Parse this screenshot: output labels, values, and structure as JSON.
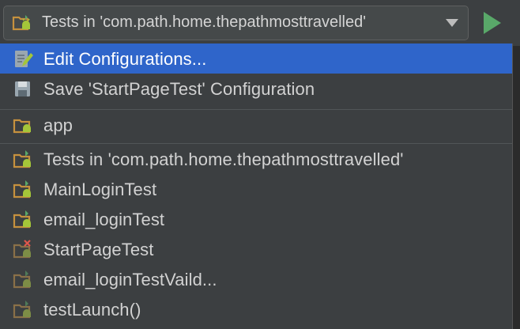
{
  "toolbar": {
    "config_selector_label": "Tests in 'com.path.home.thepathmosttravelled'",
    "config_selector_icon": "android-test-folder-icon",
    "run_icon": "run-icon",
    "run_color": "#59a869"
  },
  "popup": {
    "actions": [
      {
        "label": "Edit Configurations...",
        "icon": "edit-configurations-icon",
        "selected": true
      },
      {
        "label": "Save 'StartPageTest' Configuration",
        "icon": "save-icon",
        "selected": false
      }
    ],
    "modules": [
      {
        "label": "app",
        "icon": "android-module-icon"
      }
    ],
    "configurations": [
      {
        "label": "Tests in 'com.path.home.thepathmosttravelled'",
        "icon": "android-test-icon",
        "dimmed": false
      },
      {
        "label": "MainLoginTest",
        "icon": "android-test-icon",
        "dimmed": false
      },
      {
        "label": "email_loginTest",
        "icon": "android-test-icon",
        "dimmed": false
      },
      {
        "label": "StartPageTest",
        "icon": "android-test-error-icon",
        "dimmed": true
      },
      {
        "label": "email_loginTestVaild...",
        "icon": "android-test-icon",
        "dimmed": true
      },
      {
        "label": "testLaunch()",
        "icon": "android-test-icon",
        "dimmed": true
      }
    ]
  },
  "colors": {
    "selection": "#2f65ca",
    "popup_bg": "#3c3f41",
    "text": "#d2d2d2",
    "android_green": "#a4c639",
    "folder_orange": "#c6913e",
    "error_red": "#e0574c"
  }
}
